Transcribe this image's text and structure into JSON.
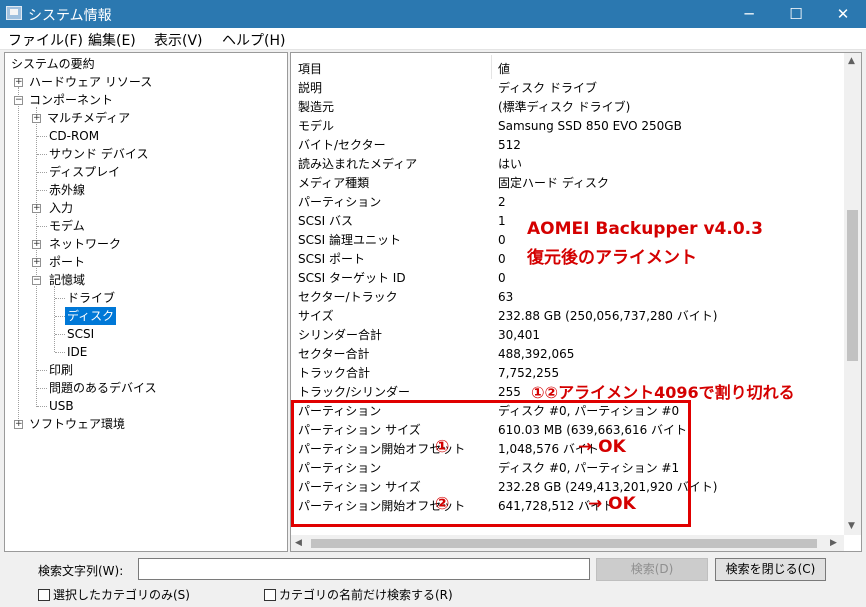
{
  "window": {
    "title": "システム情報",
    "controls": {
      "minimize": "─",
      "maximize": "☐",
      "close": "✕"
    }
  },
  "menu": [
    "ファイル(F)",
    "編集(E)",
    "表示(V)",
    "ヘルプ(H)"
  ],
  "tree": {
    "root": "システムの要約",
    "hardware": "ハードウェア リソース",
    "components": "コンポーネント",
    "multimedia": "マルチメディア",
    "cdrom": "CD-ROM",
    "sound": "サウンド デバイス",
    "display": "ディスプレイ",
    "infrared": "赤外線",
    "input": "入力",
    "modem": "モデム",
    "network": "ネットワーク",
    "ports": "ポート",
    "storage": "記憶域",
    "drives": "ドライブ",
    "disks": "ディスク",
    "scsi": "SCSI",
    "ide": "IDE",
    "printing": "印刷",
    "problem": "問題のあるデバイス",
    "usb": "USB",
    "software": "ソフトウェア環境"
  },
  "details": {
    "header_item": "項目",
    "header_value": "値",
    "rows": [
      {
        "k": "説明",
        "v": "ディスク ドライブ"
      },
      {
        "k": "製造元",
        "v": "(標準ディスク ドライブ)"
      },
      {
        "k": "モデル",
        "v": "Samsung SSD 850 EVO 250GB"
      },
      {
        "k": "バイト/セクター",
        "v": "512"
      },
      {
        "k": "読み込まれたメディア",
        "v": "はい"
      },
      {
        "k": "メディア種類",
        "v": "固定ハード ディスク"
      },
      {
        "k": "パーティション",
        "v": "2"
      },
      {
        "k": "SCSI バス",
        "v": "1"
      },
      {
        "k": "SCSI 論理ユニット",
        "v": "0"
      },
      {
        "k": "SCSI ポート",
        "v": "0"
      },
      {
        "k": "SCSI ターゲット ID",
        "v": "0"
      },
      {
        "k": "セクター/トラック",
        "v": "63"
      },
      {
        "k": "サイズ",
        "v": "232.88 GB (250,056,737,280 バイト)"
      },
      {
        "k": "シリンダー合計",
        "v": "30,401"
      },
      {
        "k": "セクター合計",
        "v": "488,392,065"
      },
      {
        "k": "トラック合計",
        "v": "7,752,255"
      },
      {
        "k": "トラック/シリンダー",
        "v": "255"
      },
      {
        "k": "パーティション",
        "v": "ディスク #0, パーティション #0"
      },
      {
        "k": "パーティション サイズ",
        "v": "610.03 MB (639,663,616 バイト)"
      },
      {
        "k": "パーティション開始オフセット",
        "v": "1,048,576 バイト"
      },
      {
        "k": "パーティション",
        "v": "ディスク #0, パーティション #1"
      },
      {
        "k": "パーティション サイズ",
        "v": "232.28 GB (249,413,201,920 バイト)"
      },
      {
        "k": "パーティション開始オフセット",
        "v": "641,728,512 バイト"
      }
    ]
  },
  "annotations": {
    "title_line1": "AOMEI Backupper v4.0.3",
    "title_line2": "復元後のアライメント",
    "alignment_note": "①②アライメント4096で割り切れる",
    "marker1": "①",
    "marker2": "②",
    "ok1": "→ OK",
    "ok2": "→ OK",
    "color": "#d40000"
  },
  "search": {
    "label": "検索文字列(W):",
    "value": "",
    "find_button": "検索(D)",
    "close_button": "検索を閉じる(C)",
    "chk_selected_category": "選択したカテゴリのみ(S)",
    "chk_category_names": "カテゴリの名前だけ検索する(R)"
  },
  "colors": {
    "titlebar": "#2b78b0",
    "selection": "#0078d7",
    "annotation": "#d40000"
  }
}
